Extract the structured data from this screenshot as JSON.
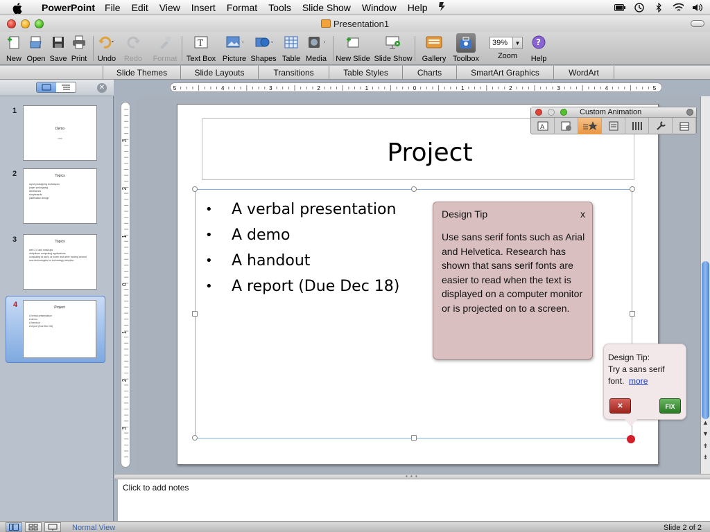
{
  "menubar": {
    "app": "PowerPoint",
    "items": [
      "File",
      "Edit",
      "View",
      "Insert",
      "Format",
      "Tools",
      "Slide Show",
      "Window",
      "Help"
    ]
  },
  "window": {
    "title": "Presentation1"
  },
  "toolbar": {
    "buttons": [
      {
        "label": "New",
        "icon": "new-doc-icon"
      },
      {
        "label": "Open",
        "icon": "open-folder-icon"
      },
      {
        "label": "Save",
        "icon": "save-disk-icon"
      },
      {
        "label": "Print",
        "icon": "printer-icon"
      },
      {
        "label": "Undo",
        "icon": "undo-icon"
      },
      {
        "label": "Redo",
        "icon": "redo-icon",
        "disabled": true
      },
      {
        "label": "Format",
        "icon": "format-brush-icon",
        "disabled": true
      },
      {
        "label": "Text Box",
        "icon": "text-box-icon"
      },
      {
        "label": "Picture",
        "icon": "picture-icon"
      },
      {
        "label": "Shapes",
        "icon": "shapes-icon"
      },
      {
        "label": "Table",
        "icon": "table-icon"
      },
      {
        "label": "Media",
        "icon": "media-icon"
      },
      {
        "label": "New Slide",
        "icon": "new-slide-icon"
      },
      {
        "label": "Slide Show",
        "icon": "slide-show-icon"
      },
      {
        "label": "Gallery",
        "icon": "gallery-icon"
      },
      {
        "label": "Toolbox",
        "icon": "toolbox-icon"
      },
      {
        "label": "Zoom",
        "icon": "zoom-icon"
      },
      {
        "label": "Help",
        "icon": "help-icon"
      }
    ],
    "zoom_value": "39%"
  },
  "ribbon_tabs": [
    "Slide Themes",
    "Slide Layouts",
    "Transitions",
    "Table Styles",
    "Charts",
    "SmartArt Graphics",
    "WordArt"
  ],
  "slides": [
    {
      "num": "1",
      "title": "Demo",
      "subtitle": "2008",
      "bullets": []
    },
    {
      "num": "2",
      "title": "Topics",
      "subtitle": "",
      "bullets": [
        "rapid prototyping techniques",
        "paper prototyping",
        "wireframes",
        "storyboards",
        "justification design"
      ]
    },
    {
      "num": "3",
      "title": "Topics",
      "subtitle": "",
      "bullets": [
        "web 2.0 and mashups",
        "ubiquitous computing applications",
        "computing at work, at home and while moving around",
        "new technologies for technology adoption"
      ]
    },
    {
      "num": "4",
      "title": "Project",
      "subtitle": "",
      "bullets": [
        "A verbal presentation",
        "A demo",
        "A handout",
        "A report (Due Dec 18)"
      ]
    }
  ],
  "slide": {
    "title": "Project",
    "bullets": [
      "A verbal presentation",
      "A demo",
      "A handout",
      "A report (Due Dec 18)"
    ],
    "bullet_glyph": "•"
  },
  "design_tip_panel": {
    "title": "Design Tip",
    "close_label": "x",
    "body": "Use sans serif fonts such as Arial and Helvetica.  Research has shown that sans serif fonts  are easier to read when the text is displayed on a computer monitor or is projected on to a screen."
  },
  "tip_bubble": {
    "line1": "Design Tip:",
    "line2": "Try a sans serif",
    "line3": "font.",
    "more_link": "more",
    "dismiss_label": "✕",
    "fix_label": "FIX"
  },
  "custom_animation": {
    "title": "Custom Animation"
  },
  "ruler": {
    "h_labels": [
      "5",
      "4",
      "3",
      "2",
      "1",
      "0",
      "1",
      "2",
      "3",
      "4",
      "5"
    ],
    "v_labels": [
      "3",
      "2",
      "1",
      "0",
      "1",
      "2",
      "3"
    ]
  },
  "notes": {
    "placeholder": "Click to add notes"
  },
  "status": {
    "view_name": "Normal View",
    "slide_counter": "Slide 2 of 2"
  },
  "colors": {
    "accent_red": "#d21f2a",
    "tip_bg": "#d9bfc0",
    "selection_blue": "#7fb0e2"
  }
}
